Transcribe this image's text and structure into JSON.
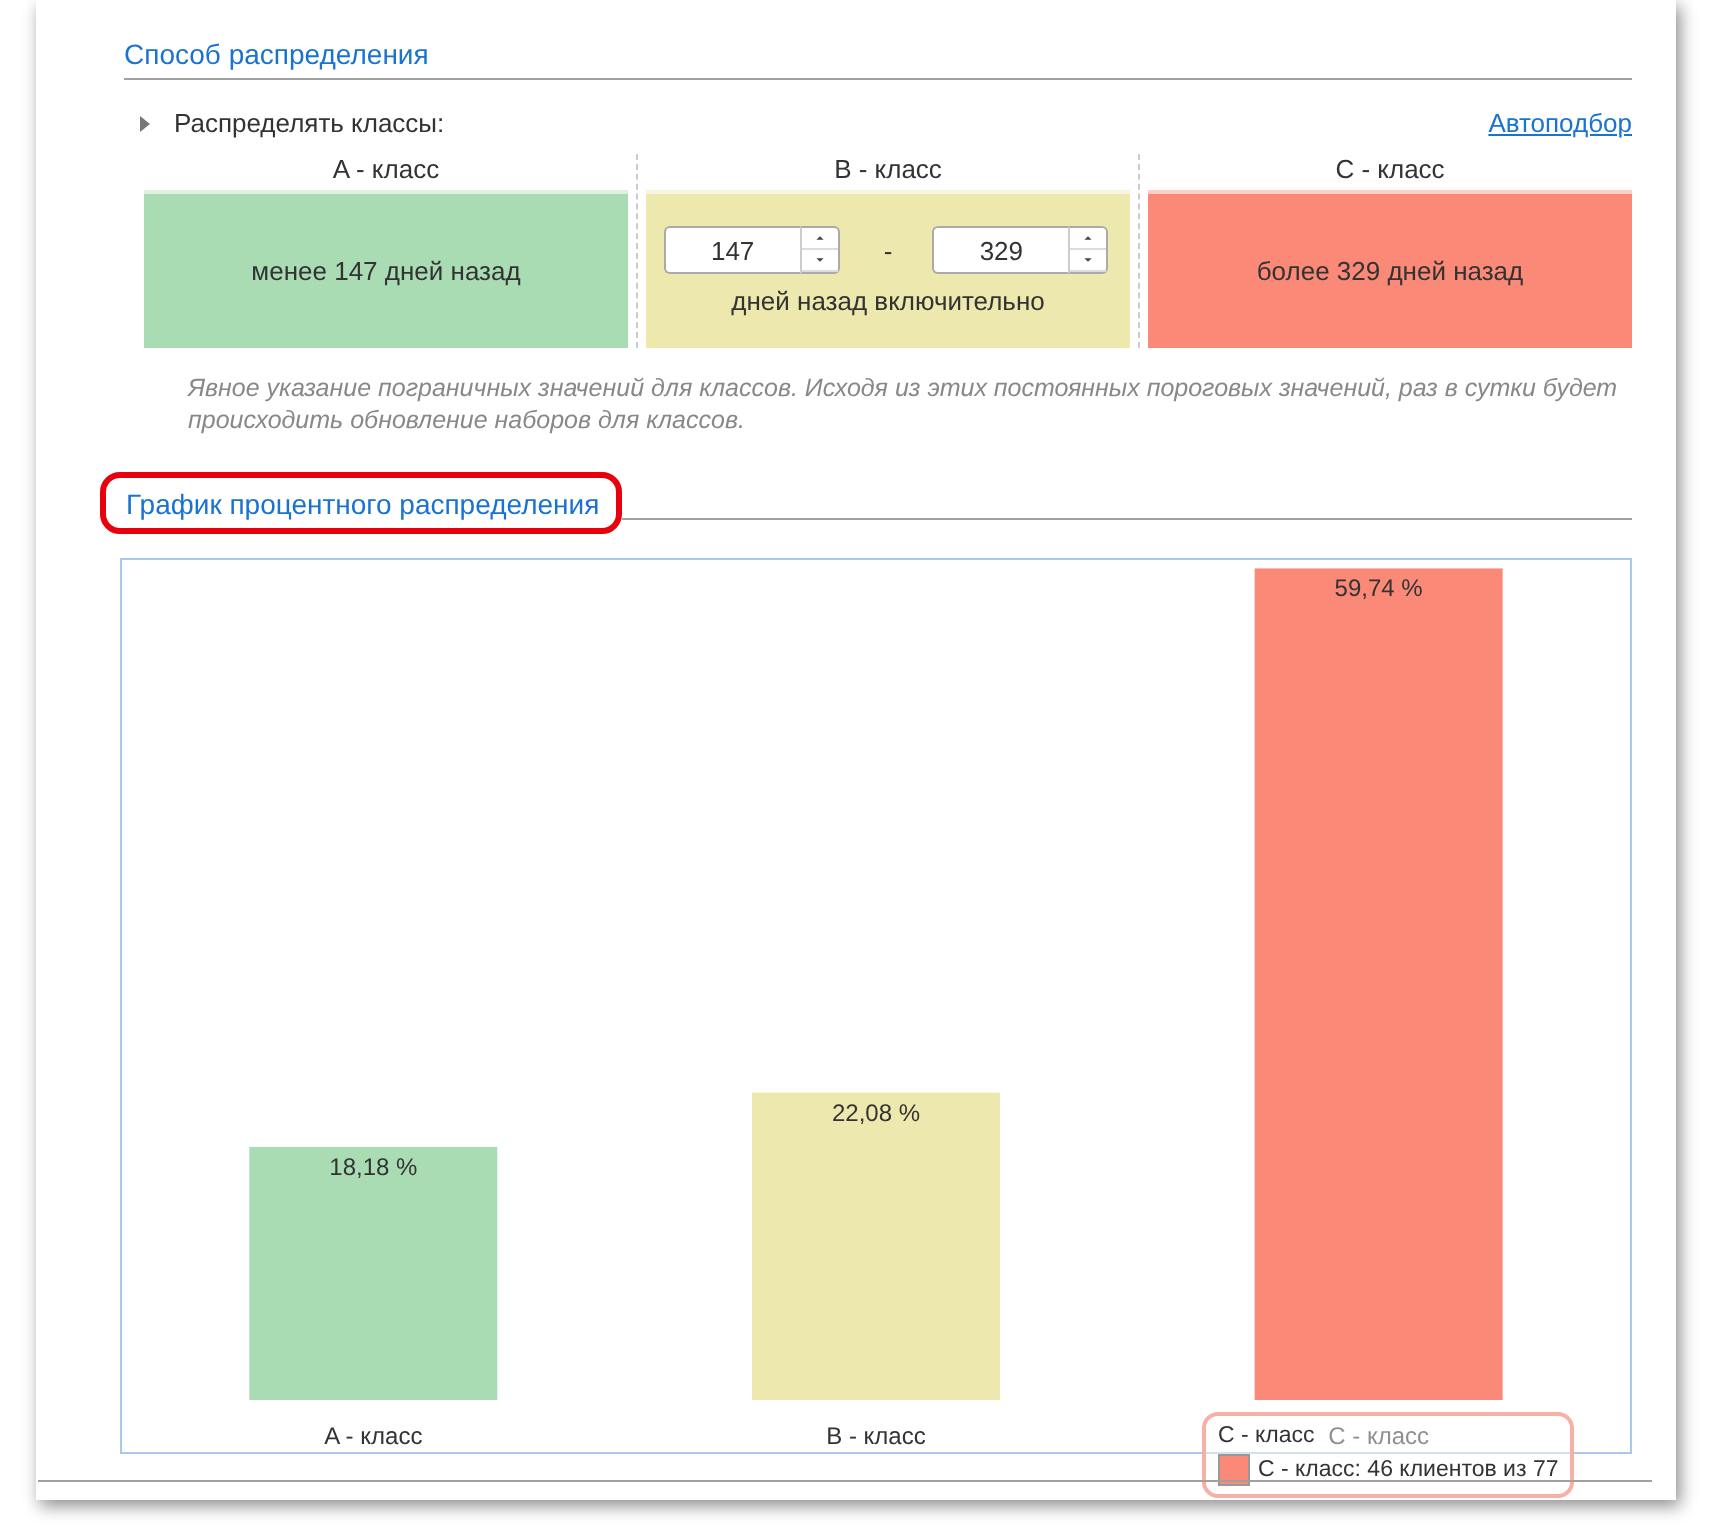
{
  "section_title": "Способ распределения",
  "distribute": {
    "label": "Распределять классы:",
    "expanded": false,
    "autopick_link": "Автоподбор"
  },
  "classes": [
    {
      "kind": "text",
      "header": "A - класс",
      "color": "#aadcb4",
      "text": "менее 147 дней назад"
    },
    {
      "kind": "range",
      "header": "B - класс",
      "color": "#ede8ae",
      "from": "147",
      "separator": "-",
      "to": "329",
      "caption": "дней назад включительно"
    },
    {
      "kind": "text",
      "header": "C - класс",
      "color": "#fa8978",
      "text": "более 329 дней назад"
    }
  ],
  "hint": "Явное указание пограничных значений для классов. Исходя из этих постоянных пороговых значений, раз в сутки будет происходить обновление наборов для классов.",
  "chart_section": {
    "title": "График процентного распределения",
    "highlighted": true,
    "chart_data": {
      "type": "bar",
      "categories": [
        "A - класс",
        "B - класс",
        "C - класс"
      ],
      "values": [
        18.18,
        22.08,
        59.74
      ],
      "value_labels": [
        "18,18 %",
        "22,08 %",
        "59,74 %"
      ]
    },
    "tooltip": {
      "title": "C - класс",
      "text": "C - класс: 46 клиентов из 77",
      "color": "#fa8978"
    }
  }
}
